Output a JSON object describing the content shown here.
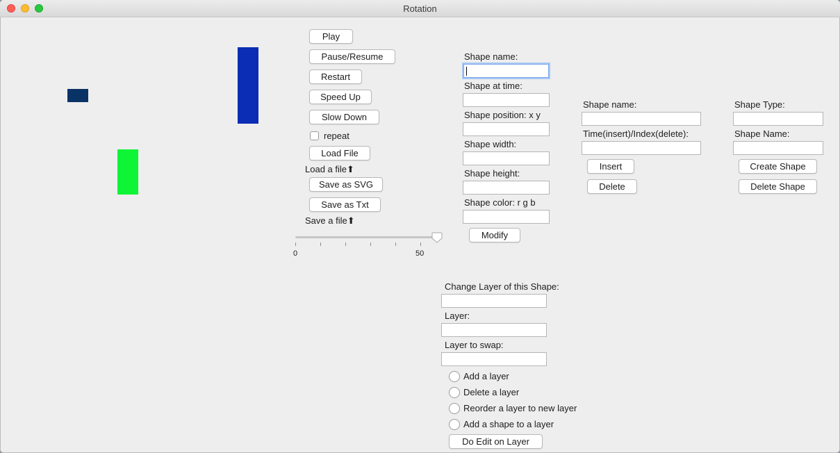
{
  "window": {
    "title": "Rotation"
  },
  "canvas": {
    "shapes": [
      {
        "name": "dark-blue-rectangle",
        "color": "#0a3365"
      },
      {
        "name": "blue-rectangle",
        "color": "#0b2cb4"
      },
      {
        "name": "green-rectangle",
        "color": "#0df535"
      }
    ]
  },
  "controls": {
    "play": "Play",
    "pause_resume": "Pause/Resume",
    "restart": "Restart",
    "speed_up": "Speed Up",
    "slow_down": "Slow Down",
    "repeat": "repeat",
    "load_file": "Load File",
    "load_hint": "Load a file⬆",
    "save_svg": "Save as SVG",
    "save_txt": "Save as Txt",
    "save_hint": "Save a file⬆"
  },
  "slider": {
    "min": "0",
    "max": "50",
    "value": 57
  },
  "modify_panel": {
    "shape_name": "Shape name:",
    "shape_time": "Shape at time:",
    "shape_position": "Shape position: x y",
    "shape_width": "Shape width:",
    "shape_height": "Shape height:",
    "shape_color": "Shape color: r g b",
    "modify": "Modify"
  },
  "keyframe_panel": {
    "shape_name": "Shape name:",
    "time_index": "Time(insert)/Index(delete):",
    "insert": "Insert",
    "delete": "Delete"
  },
  "shape_panel": {
    "shape_type": "Shape Type:",
    "shape_name": "Shape Name:",
    "create": "Create Shape",
    "delete": "Delete Shape"
  },
  "layer_panel": {
    "change_layer": "Change Layer of this Shape:",
    "layer": "Layer:",
    "layer_swap": "Layer to swap:",
    "options": [
      "Add a layer",
      "Delete a layer",
      "Reorder a layer to new layer",
      "Add a shape to a layer"
    ],
    "do_edit": "Do Edit on Layer"
  }
}
